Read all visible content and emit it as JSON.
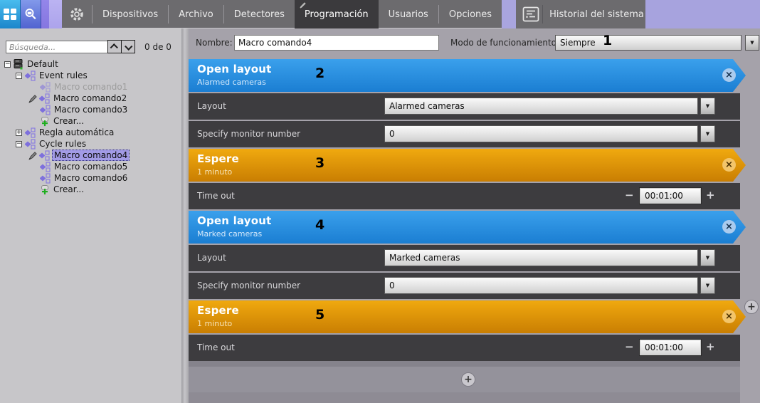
{
  "toolbar": {
    "tabs": [
      {
        "label": "Dispositivos",
        "active": false
      },
      {
        "label": "Archivo",
        "active": false
      },
      {
        "label": "Detectores",
        "active": false
      },
      {
        "label": "Programación",
        "active": true
      },
      {
        "label": "Usuarios",
        "active": false
      },
      {
        "label": "Opciones",
        "active": false
      }
    ],
    "history": {
      "label": "Historial del sistema",
      "icon": "history-icon"
    },
    "icons": {
      "layout_button": "grid-icon",
      "search_button": "search-icon",
      "settings": "gear-icon",
      "active_tab_marker": "pencil-icon"
    }
  },
  "sidebar": {
    "search": {
      "placeholder": "Búsqueda...",
      "counter": "0 de 0"
    },
    "tree": [
      {
        "label": "Default",
        "icon": "server-icon",
        "level": 0,
        "expander": "minus",
        "pencil": false,
        "faded": false,
        "selected": false
      },
      {
        "label": "Event rules",
        "icon": "rule-icon",
        "level": 1,
        "expander": "minus",
        "pencil": false,
        "faded": false,
        "selected": false
      },
      {
        "label": "Macro comando1",
        "icon": "rule-icon",
        "level": 2,
        "expander": null,
        "pencil": false,
        "faded": true,
        "selected": false
      },
      {
        "label": "Macro comando2",
        "icon": "rule-icon",
        "level": 2,
        "expander": null,
        "pencil": true,
        "faded": false,
        "selected": false
      },
      {
        "label": "Macro comando3",
        "icon": "rule-icon",
        "level": 2,
        "expander": null,
        "pencil": false,
        "faded": false,
        "selected": false
      },
      {
        "label": "Crear...",
        "icon": "create-icon",
        "level": 2,
        "expander": null,
        "pencil": false,
        "faded": false,
        "selected": false
      },
      {
        "label": "Regla automática",
        "icon": "rule-icon",
        "level": 1,
        "expander": "plus",
        "pencil": false,
        "faded": false,
        "selected": false
      },
      {
        "label": "Cycle rules",
        "icon": "rule-icon",
        "level": 1,
        "expander": "minus",
        "pencil": false,
        "faded": false,
        "selected": false
      },
      {
        "label": "Macro comando4",
        "icon": "rule-icon",
        "level": 2,
        "expander": null,
        "pencil": true,
        "faded": false,
        "selected": true
      },
      {
        "label": "Macro comando5",
        "icon": "rule-icon",
        "level": 2,
        "expander": null,
        "pencil": false,
        "faded": false,
        "selected": false
      },
      {
        "label": "Macro comando6",
        "icon": "rule-icon",
        "level": 2,
        "expander": null,
        "pencil": false,
        "faded": false,
        "selected": false
      },
      {
        "label": "Crear...",
        "icon": "create-icon",
        "level": 2,
        "expander": null,
        "pencil": false,
        "faded": false,
        "selected": false
      }
    ]
  },
  "main": {
    "name_label": "Nombre:",
    "name_value": "Macro comando4",
    "mode_label": "Modo de funcionamiento",
    "mode_value": "Siempre",
    "mode_annotation": "1"
  },
  "blocks": [
    {
      "type": "open_layout",
      "title": "Open layout",
      "subtitle": "Alarmed cameras",
      "annotation": "2",
      "rows": [
        {
          "label": "Layout",
          "value": "Alarmed cameras",
          "control": "dropdown"
        },
        {
          "label": "Specify monitor number",
          "value": "0",
          "control": "dropdown"
        }
      ]
    },
    {
      "type": "wait",
      "title": "Espere",
      "subtitle": "1 minuto",
      "annotation": "3",
      "rows": [
        {
          "label": "Time out",
          "value": "00:01:00",
          "control": "stepper"
        }
      ]
    },
    {
      "type": "open_layout",
      "title": "Open layout",
      "subtitle": "Marked cameras",
      "annotation": "4",
      "rows": [
        {
          "label": "Layout",
          "value": "Marked cameras",
          "control": "dropdown"
        },
        {
          "label": "Specify monitor number",
          "value": "0",
          "control": "dropdown"
        }
      ]
    },
    {
      "type": "wait",
      "title": "Espere",
      "subtitle": "1 minuto",
      "annotation": "5",
      "rows": [
        {
          "label": "Time out",
          "value": "00:01:00",
          "control": "stepper"
        }
      ]
    }
  ],
  "glyphs": {
    "dropdown_arrow": "▼",
    "close": "×",
    "plus": "+",
    "minus": "−",
    "collapse": "−",
    "expand": "+"
  },
  "colors": {
    "accent_blue": "#2189dc",
    "accent_orange": "#e39a0b",
    "selection_purple": "#a29be5",
    "lavender": "#a7a3de",
    "row_dark": "#3d3c3f",
    "toolbar_gray": "#6c6b6e",
    "sidebar_gray": "#c7c6c9"
  }
}
